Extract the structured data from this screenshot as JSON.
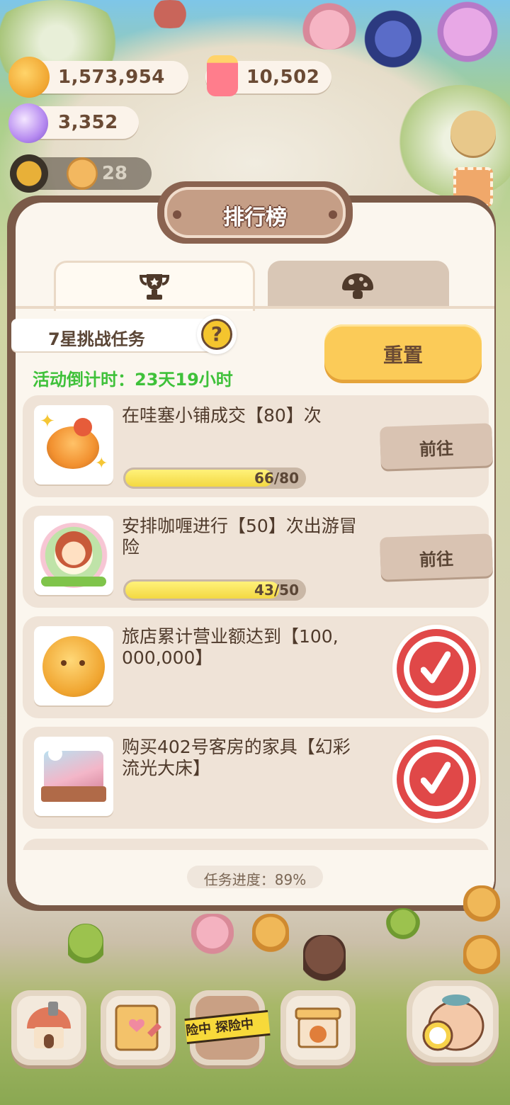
{
  "currency": {
    "coins": "1,573,954",
    "candles": "10,502",
    "gems": "3,352",
    "level_count": "28"
  },
  "panel": {
    "title": "排行榜",
    "tabs": [
      {
        "icon": "trophy-icon",
        "active": true
      },
      {
        "icon": "mushroom-icon",
        "active": false
      }
    ],
    "challenge_label": "7星挑战任务",
    "help_symbol": "?",
    "countdown": "活动倒计时：23天19小时",
    "reset_label": "重置",
    "progress_text": "任务进度：89%"
  },
  "tasks": [
    {
      "text": "在哇塞小铺成交【80】次",
      "progress_label": "66/80",
      "progress": 0.825,
      "action": "前往",
      "done": false,
      "icon": "cake-icon"
    },
    {
      "text": "安排咖喱进行【50】次出游冒险",
      "progress_label": "43/50",
      "progress": 0.86,
      "action": "前往",
      "done": false,
      "icon": "curry-character-icon"
    },
    {
      "text": "旅店累计营业额达到【100,000,000】",
      "done": true,
      "icon": "gold-coin-icon"
    },
    {
      "text": "购买402号客房的家具【幻彩流光大床】",
      "done": true,
      "icon": "bed-icon"
    }
  ],
  "bottom_nav": {
    "adventure_tape": "险中 探险中"
  },
  "colors": {
    "accent_yellow": "#fbcb58",
    "countdown_green": "#3fc13a",
    "stamp_red": "#e04848",
    "panel_brown": "#7a5a48"
  }
}
